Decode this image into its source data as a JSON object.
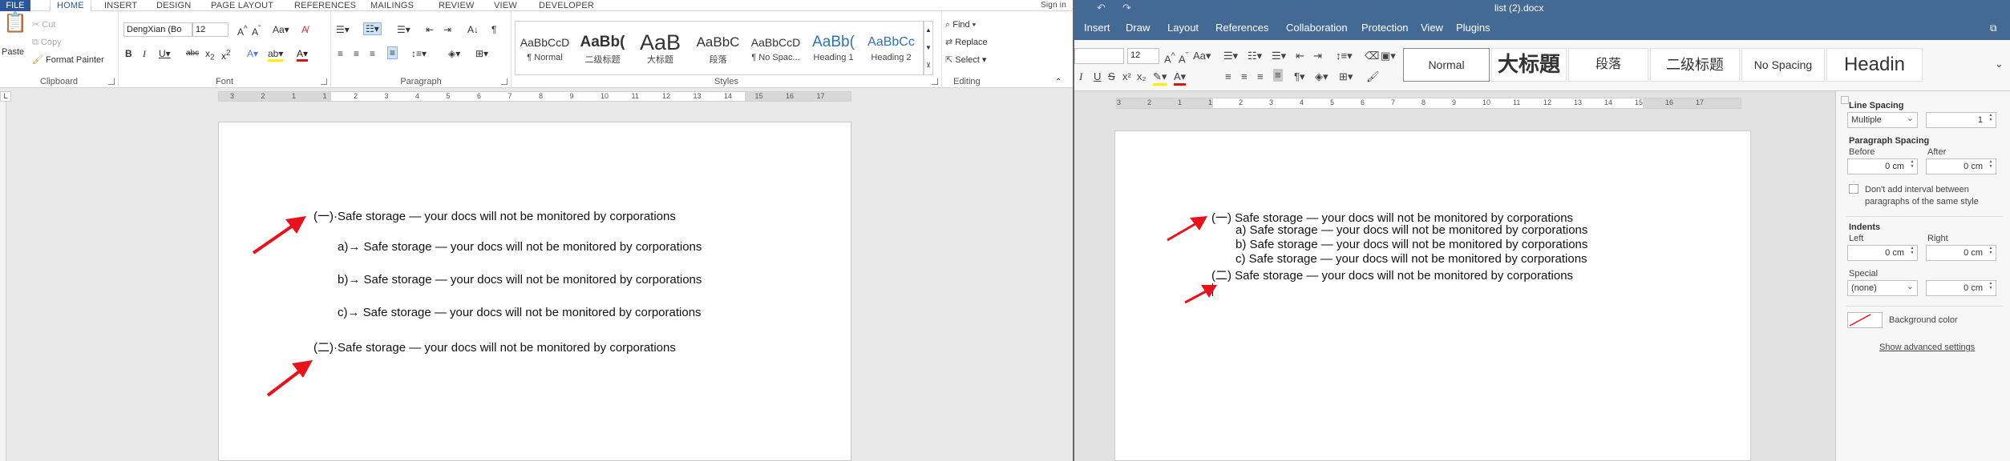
{
  "word": {
    "tabs": [
      "FILE",
      "HOME",
      "INSERT",
      "DESIGN",
      "PAGE LAYOUT",
      "REFERENCES",
      "MAILINGS",
      "REVIEW",
      "VIEW",
      "DEVELOPER"
    ],
    "sign_in": "Sign in",
    "clipboard": {
      "paste": "Paste",
      "cut": "Cut",
      "copy": "Copy",
      "format_painter": "Format Painter",
      "label": "Clipboard"
    },
    "font": {
      "name": "DengXian (Bo",
      "size": "12",
      "label": "Font"
    },
    "paragraph": {
      "label": "Paragraph"
    },
    "styles": {
      "label": "Styles",
      "items": [
        {
          "preview": "AaBbCcD",
          "name": "¶ Normal"
        },
        {
          "preview": "AaBb(",
          "name": "二级标题"
        },
        {
          "preview": "AaB",
          "name": "大标题"
        },
        {
          "preview": "AaBbC",
          "name": "段落"
        },
        {
          "preview": "AaBbCcD",
          "name": "¶ No Spac..."
        },
        {
          "preview": "AaBb(",
          "name": "Heading 1"
        },
        {
          "preview": "AaBbCc",
          "name": "Heading 2"
        }
      ]
    },
    "editing": {
      "find": "Find",
      "replace": "Replace",
      "select": "Select",
      "label": "Editing"
    },
    "ruler_numbers": [
      "3",
      "2",
      "1",
      "1",
      "2",
      "3",
      "4",
      "5",
      "6",
      "7",
      "8",
      "9",
      "10",
      "11",
      "12",
      "13",
      "14",
      "15",
      "16",
      "17"
    ],
    "doc_lines": [
      "(一)·Safe storage — your docs will not be monitored by corporations",
      "a)→ Safe storage — your docs will not be monitored by corporations",
      "b)→ Safe storage — your docs will not be monitored by corporations",
      "c)→ Safe storage — your docs will not be monitored by corporations",
      "(二)·Safe storage — your docs will not be monitored by corporations"
    ]
  },
  "onlyoffice": {
    "title": "list (2).docx",
    "tabs": [
      "Insert",
      "Draw",
      "Layout",
      "References",
      "Collaboration",
      "Protection",
      "View",
      "Plugins"
    ],
    "font_size": "12",
    "styles": [
      "Normal",
      "大标題",
      "段落",
      "二级标题",
      "No Spacing",
      "Headin"
    ],
    "ruler_numbers": [
      "3",
      "2",
      "1",
      "1",
      "2",
      "3",
      "4",
      "5",
      "6",
      "7",
      "8",
      "9",
      "10",
      "11",
      "12",
      "13",
      "14",
      "15",
      "16",
      "17"
    ],
    "doc_lines": [
      "(一) Safe storage — your docs will not be monitored by corporations",
      "a)   Safe storage — your docs will not be monitored by corporations",
      "b)   Safe storage — your docs will not be monitored by corporations",
      "c)   Safe storage — your docs will not be monitored by corporations",
      "(二) Safe storage — your docs will not be monitored by corporations"
    ],
    "panel": {
      "line_spacing": "Line Spacing",
      "line_spacing_mode": "Multiple",
      "line_spacing_value": "1",
      "paragraph_spacing": "Paragraph Spacing",
      "before": "Before",
      "after": "After",
      "before_value": "0 cm",
      "after_value": "0 cm",
      "dont_add_interval": "Don't add interval between paragraphs of the same style",
      "indents": "Indents",
      "left": "Left",
      "right": "Right",
      "left_value": "0 cm",
      "right_value": "0 cm",
      "special": "Special",
      "special_mode": "(none)",
      "special_value": "0 cm",
      "background_color": "Background color",
      "show_advanced": "Show advanced settings"
    }
  },
  "colors": {
    "word_blue": "#2b579a",
    "oo_blue": "#446995",
    "arrow_red": "#e8121c"
  }
}
